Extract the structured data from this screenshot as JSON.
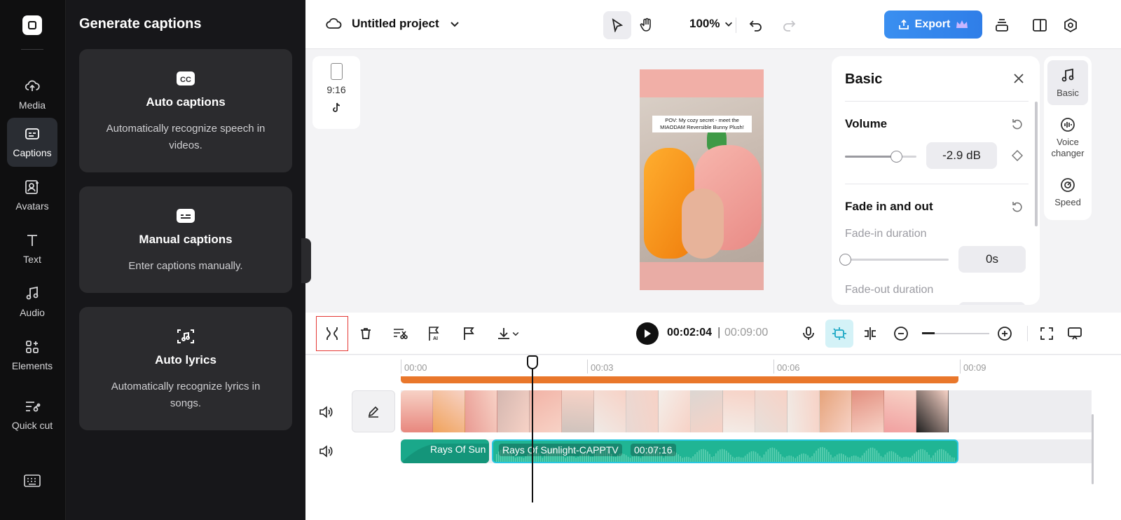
{
  "rail": {
    "items": [
      {
        "label": "Media",
        "icon": "cloud-upload-icon"
      },
      {
        "label": "Captions",
        "icon": "captions-icon",
        "active": true
      },
      {
        "label": "Avatars",
        "icon": "avatar-icon"
      },
      {
        "label": "Text",
        "icon": "text-icon"
      },
      {
        "label": "Audio",
        "icon": "music-note-icon"
      },
      {
        "label": "Elements",
        "icon": "elements-icon"
      },
      {
        "label": "Quick cut",
        "icon": "quick-cut-icon"
      }
    ],
    "keyboard_icon": "keyboard-icon"
  },
  "panel": {
    "title": "Generate captions",
    "cards": [
      {
        "title": "Auto captions",
        "desc": "Automatically recognize speech in videos.",
        "icon": "cc-icon"
      },
      {
        "title": "Manual captions",
        "desc": "Enter captions manually.",
        "icon": "subtitle-icon"
      },
      {
        "title": "Auto lyrics",
        "desc": "Automatically recognize lyrics in songs.",
        "icon": "lyrics-icon"
      }
    ]
  },
  "topbar": {
    "project_name": "Untitled project",
    "zoom": "100%",
    "export_label": "Export"
  },
  "canvas": {
    "ratio": "9:16",
    "caption_text": "POV: My cozy secret - meet the MIAODAM Reversible Bunny Plush!"
  },
  "basic": {
    "title": "Basic",
    "volume_label": "Volume",
    "volume_value": "-2.9 dB",
    "volume_level": 0.72,
    "fade_label": "Fade in and out",
    "fade_in_label": "Fade-in duration",
    "fade_in_value": "0s",
    "fade_out_label": "Fade-out duration"
  },
  "right_tools": [
    {
      "label": "Basic",
      "icon": "music-note-icon"
    },
    {
      "label": "Voice changer",
      "icon": "voice-changer-icon"
    },
    {
      "label": "Speed",
      "icon": "speed-icon"
    }
  ],
  "timeline": {
    "current_time": "00:02:04",
    "separator": "|",
    "total_time": "00:09:00",
    "ticks": [
      "00:00",
      "00:03",
      "00:06",
      "00:09"
    ],
    "audio_clip_1": "Rays Of Sun",
    "audio_clip_2": "Rays Of Sunlight-CAPPTV",
    "audio_clip_2_duration": "00:07:16"
  },
  "colors": {
    "accent": "#2f7ee8",
    "timeline_orange": "#e9772b",
    "audio_green": "#20b594",
    "selection_red": "#e53935"
  }
}
